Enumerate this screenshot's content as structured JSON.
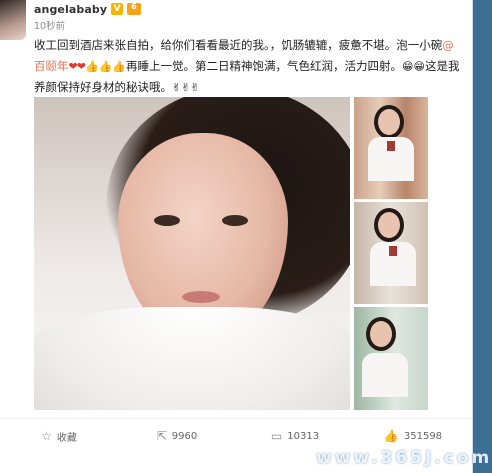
{
  "post": {
    "username": "angelababy",
    "verified_badge": "V",
    "time": "10秒前",
    "text_before_mention": "收工回到酒店来张自拍，给你们看看最近的我。，饥肠辘辘，疲惫不堪。泡一小碗",
    "mention": "@百颐年",
    "text_after_mention": "再睡上一觉。第二日精神饱满，气色红润，活力四射。",
    "text_end": "这是我养颜保持好身材的秘诀哦。",
    "icons": [
      "heart-emoji",
      "thumbs-up-emoji",
      "grin-emoji",
      "victory-hand-emoji"
    ]
  },
  "actions": {
    "favorite": "收藏",
    "repost": "9960",
    "comment": "10313",
    "like": "351598"
  },
  "watermark": "www.365J.com",
  "colors": {
    "mention": "#eb7350",
    "background": "#e9eef3",
    "sidebar": "#3b6f94"
  }
}
